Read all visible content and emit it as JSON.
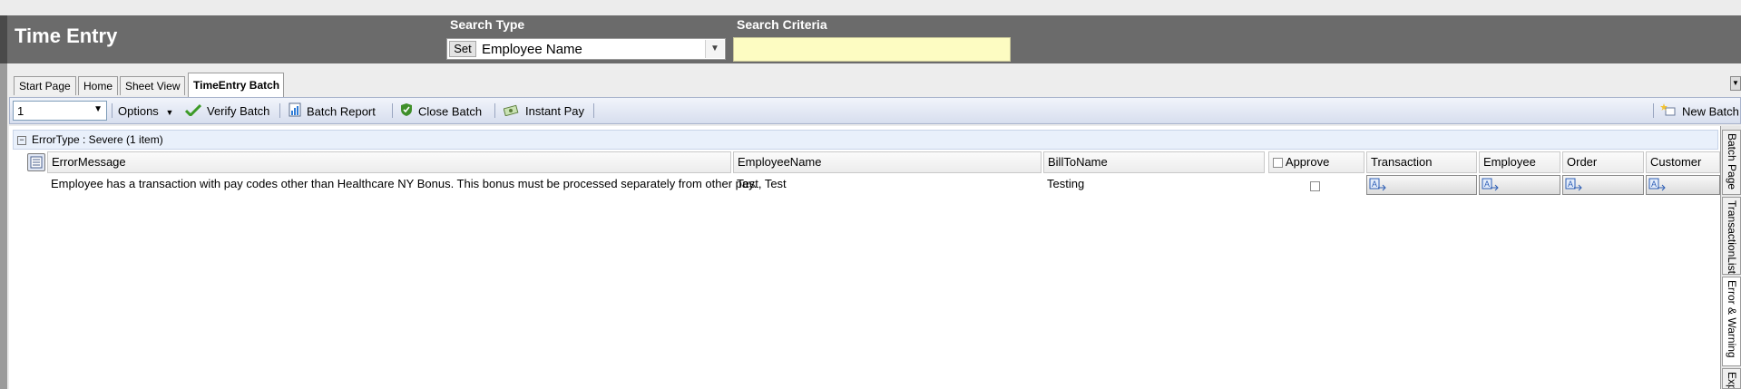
{
  "header": {
    "title": "Time Entry",
    "search_type_label": "Search Type",
    "set_label": "Set",
    "search_type_value": "Employee Name",
    "search_criteria_label": "Search Criteria",
    "search_criteria_value": ""
  },
  "tabs": [
    "Start Page",
    "Home",
    "Sheet View",
    "TimeEntry Batch"
  ],
  "toolbar": {
    "batch_number": "1",
    "options_label": "Options",
    "verify_batch_label": "Verify Batch",
    "batch_report_label": "Batch Report",
    "close_batch_label": "Close Batch",
    "instant_pay_label": "Instant Pay",
    "new_batch_label": "New Batch"
  },
  "grid": {
    "group_label": "ErrorType : Severe (1 item)",
    "columns": [
      "ErrorMessage",
      "EmployeeName",
      "BillToName",
      "Approve",
      "Transaction",
      "Employee",
      "Order",
      "Customer"
    ],
    "rows": [
      {
        "error_message": "Employee has a transaction with pay codes other than Healthcare NY Bonus. This bonus must be processed separately from other pay.",
        "employee_name": "Test, Test",
        "bill_to_name": "Testing"
      }
    ]
  },
  "side_tabs": [
    "Batch Page",
    "TransactionList",
    "Error & Warning",
    "Exp"
  ],
  "colors": {
    "header_bg": "#6b6b6b",
    "search_criteria_bg": "#fdfcc2",
    "toolbar_bg": "#dce3f1",
    "group_row_bg": "#e9f0fb"
  }
}
